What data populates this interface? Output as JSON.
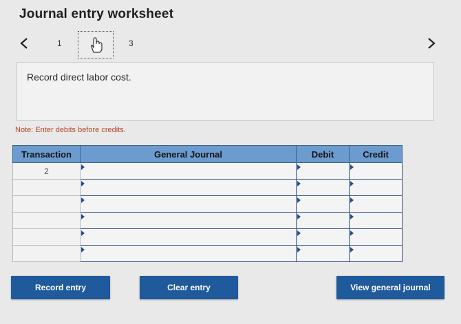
{
  "header": {
    "title": "Journal entry worksheet"
  },
  "nav": {
    "pages": [
      "1",
      "3"
    ],
    "current_icon": "hand-pointer-icon"
  },
  "instruction": {
    "text": "Record direct labor cost."
  },
  "note": "Note: Enter debits before credits.",
  "table": {
    "columns": [
      "Transaction",
      "General Journal",
      "Debit",
      "Credit"
    ],
    "rows": [
      {
        "transaction": "2",
        "account": "",
        "debit": "",
        "credit": ""
      },
      {
        "transaction": "",
        "account": "",
        "debit": "",
        "credit": ""
      },
      {
        "transaction": "",
        "account": "",
        "debit": "",
        "credit": ""
      },
      {
        "transaction": "",
        "account": "",
        "debit": "",
        "credit": ""
      },
      {
        "transaction": "",
        "account": "",
        "debit": "",
        "credit": ""
      },
      {
        "transaction": "",
        "account": "",
        "debit": "",
        "credit": ""
      }
    ]
  },
  "buttons": {
    "record": "Record entry",
    "clear": "Clear entry",
    "view": "View general journal"
  },
  "colors": {
    "header_bg": "#6c9bcf",
    "button_bg": "#1f5a9c",
    "note": "#b5462c"
  }
}
